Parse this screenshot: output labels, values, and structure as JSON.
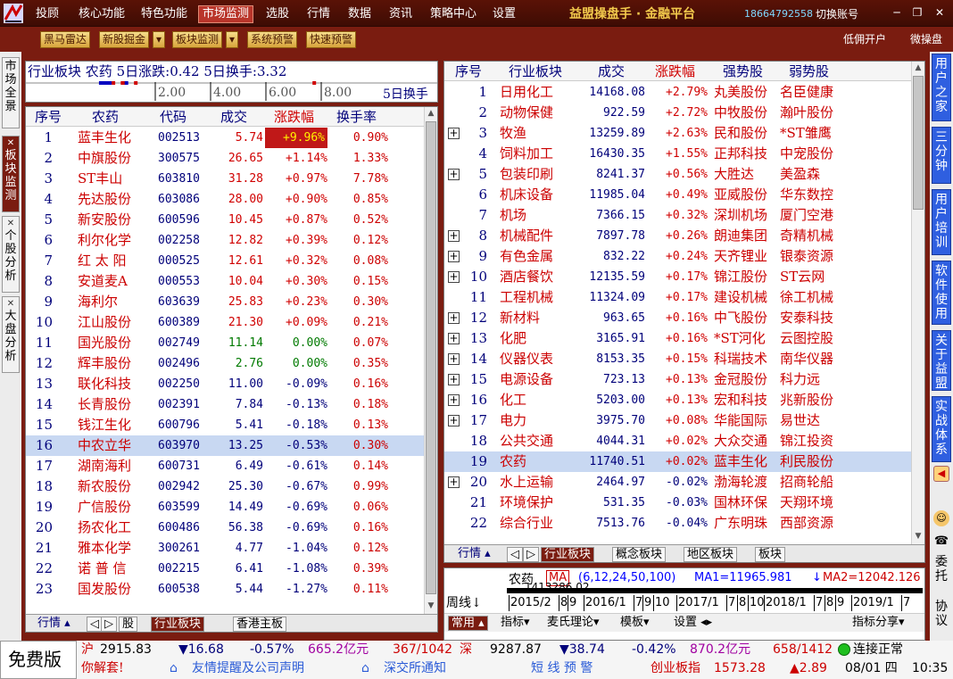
{
  "topbar": {
    "menu": [
      "投顾",
      "核心功能",
      "特色功能",
      "市场监测",
      "选股",
      "行情",
      "数据",
      "资讯",
      "策略中心",
      "设置"
    ],
    "active_index": 3,
    "brand": "益盟操盘手 · 金融平台",
    "phone": "18664792558",
    "switch_account": "切换账号",
    "win_controls": [
      "─",
      "❐",
      "✕"
    ]
  },
  "toolbar": {
    "buttons": [
      "黑马雷达",
      "新股掘金",
      "板块监测",
      "系统预警",
      "快速预警"
    ],
    "right": [
      "低佣开户",
      "微操盘"
    ]
  },
  "left_tabs": [
    "市场全景",
    "板块监测",
    "个股分析",
    "大盘分析"
  ],
  "left_tabs_active": 1,
  "summary": {
    "label": "行业板块",
    "sector": "农药",
    "gain_label": "5日涨跌:",
    "gain": "0.42",
    "turnover_label": "5日换手:",
    "turnover": "3.32",
    "ticks": [
      "2.00",
      "4.00",
      "6.00",
      "8.00"
    ],
    "axis_title": "5日换手"
  },
  "stock_table": {
    "headers": [
      "序号",
      "农药",
      "代码",
      "成交",
      "涨跌幅",
      "换手率"
    ],
    "rows": [
      [
        "1",
        "蓝丰生化",
        "002513",
        "5.74",
        "+9.96%",
        "0.90%"
      ],
      [
        "2",
        "中旗股份",
        "300575",
        "26.65",
        "+1.14%",
        "1.33%"
      ],
      [
        "3",
        "ST丰山",
        "603810",
        "31.28",
        "+0.97%",
        "7.78%"
      ],
      [
        "4",
        "先达股份",
        "603086",
        "28.00",
        "+0.90%",
        "0.85%"
      ],
      [
        "5",
        "新安股份",
        "600596",
        "10.45",
        "+0.87%",
        "0.52%"
      ],
      [
        "6",
        "利尔化学",
        "002258",
        "12.82",
        "+0.39%",
        "0.12%"
      ],
      [
        "7",
        "红 太 阳",
        "000525",
        "12.61",
        "+0.32%",
        "0.08%"
      ],
      [
        "8",
        "安道麦A",
        "000553",
        "10.04",
        "+0.30%",
        "0.15%"
      ],
      [
        "9",
        "海利尔",
        "603639",
        "25.83",
        "+0.23%",
        "0.30%"
      ],
      [
        "10",
        "江山股份",
        "600389",
        "21.30",
        "+0.09%",
        "0.21%"
      ],
      [
        "11",
        "国光股份",
        "002749",
        "11.14",
        "0.00%",
        "0.07%"
      ],
      [
        "12",
        "辉丰股份",
        "002496",
        "2.76",
        "0.00%",
        "0.35%"
      ],
      [
        "13",
        "联化科技",
        "002250",
        "11.00",
        "-0.09%",
        "0.16%"
      ],
      [
        "14",
        "长青股份",
        "002391",
        "7.84",
        "-0.13%",
        "0.18%"
      ],
      [
        "15",
        "钱江生化",
        "600796",
        "5.41",
        "-0.18%",
        "0.13%"
      ],
      [
        "16",
        "中农立华",
        "603970",
        "13.25",
        "-0.53%",
        "0.30%"
      ],
      [
        "17",
        "湖南海利",
        "600731",
        "6.49",
        "-0.61%",
        "0.14%"
      ],
      [
        "18",
        "新农股份",
        "002942",
        "25.30",
        "-0.67%",
        "0.99%"
      ],
      [
        "19",
        "广信股份",
        "603599",
        "14.49",
        "-0.69%",
        "0.06%"
      ],
      [
        "20",
        "扬农化工",
        "600486",
        "56.38",
        "-0.69%",
        "0.16%"
      ],
      [
        "21",
        "雅本化学",
        "300261",
        "4.77",
        "-1.04%",
        "0.12%"
      ],
      [
        "22",
        "诺 普 信",
        "002215",
        "6.41",
        "-1.08%",
        "0.39%"
      ],
      [
        "23",
        "国发股份",
        "600538",
        "5.44",
        "-1.27%",
        "0.11%"
      ]
    ],
    "selected_index": 15
  },
  "left_tabbar": {
    "label": "行情",
    "items": [
      "股",
      "行业板块",
      "香港主板"
    ],
    "active": 1
  },
  "sector_table": {
    "headers": [
      "序号",
      "行业板块",
      "成交",
      "涨跌幅",
      "强势股",
      "弱势股"
    ],
    "rows": [
      [
        "1",
        "日用化工",
        "14168.08",
        "+2.79%",
        "丸美股份",
        "名臣健康",
        false
      ],
      [
        "2",
        "动物保健",
        "922.59",
        "+2.72%",
        "中牧股份",
        "瀚叶股份",
        false
      ],
      [
        "3",
        "牧渔",
        "13259.89",
        "+2.63%",
        "民和股份",
        "*ST雏鹰",
        true
      ],
      [
        "4",
        "饲料加工",
        "16430.35",
        "+1.55%",
        "正邦科技",
        "中宠股份",
        false
      ],
      [
        "5",
        "包装印刷",
        "8241.37",
        "+0.56%",
        "大胜达",
        "美盈森",
        true
      ],
      [
        "6",
        "机床设备",
        "11985.04",
        "+0.49%",
        "亚威股份",
        "华东数控",
        false
      ],
      [
        "7",
        "机场",
        "7366.15",
        "+0.32%",
        "深圳机场",
        "厦门空港",
        false
      ],
      [
        "8",
        "机械配件",
        "7897.78",
        "+0.26%",
        "朗迪集团",
        "奇精机械",
        true
      ],
      [
        "9",
        "有色金属",
        "832.22",
        "+0.24%",
        "天齐锂业",
        "银泰资源",
        true
      ],
      [
        "10",
        "酒店餐饮",
        "12135.59",
        "+0.17%",
        "锦江股份",
        "ST云网",
        true
      ],
      [
        "11",
        "工程机械",
        "11324.09",
        "+0.17%",
        "建设机械",
        "徐工机械",
        false
      ],
      [
        "12",
        "新材料",
        "963.65",
        "+0.16%",
        "中飞股份",
        "安泰科技",
        true
      ],
      [
        "13",
        "化肥",
        "3165.91",
        "+0.16%",
        "*ST河化",
        "云图控股",
        true
      ],
      [
        "14",
        "仪器仪表",
        "8153.35",
        "+0.15%",
        "科瑞技术",
        "南华仪器",
        true
      ],
      [
        "15",
        "电源设备",
        "723.13",
        "+0.13%",
        "金冠股份",
        "科力远",
        true
      ],
      [
        "16",
        "化工",
        "5203.00",
        "+0.13%",
        "宏和科技",
        "兆新股份",
        true
      ],
      [
        "17",
        "电力",
        "3975.70",
        "+0.08%",
        "华能国际",
        "易世达",
        true
      ],
      [
        "18",
        "公共交通",
        "4044.31",
        "+0.02%",
        "大众交通",
        "锦江投资",
        false
      ],
      [
        "19",
        "农药",
        "11740.51",
        "+0.02%",
        "蓝丰生化",
        "利民股份",
        false
      ],
      [
        "20",
        "水上运输",
        "2464.97",
        "-0.02%",
        "渤海轮渡",
        "招商轮船",
        true
      ],
      [
        "21",
        "环境保护",
        "531.35",
        "-0.03%",
        "国林环保",
        "天翔环境",
        false
      ],
      [
        "22",
        "综合行业",
        "7513.76",
        "-0.04%",
        "广东明珠",
        "西部资源",
        false
      ]
    ],
    "selected_index": 18
  },
  "right_tabbar": {
    "label": "行情",
    "items": [
      "行业板块",
      "概念板块",
      "地区板块",
      "板块"
    ],
    "active": 0
  },
  "mini_chart": {
    "name": "农药",
    "ma_tag": "MA",
    "params": "(6,12,24,50,100)",
    "ma1": "MA1=11965.981",
    "ma2": "MA2=12042.126",
    "overlay": "1413286.02",
    "period": "周线",
    "years": [
      "2015/2",
      "8",
      "9",
      "2016/1",
      "7",
      "9",
      "10",
      "2017/1",
      "7",
      "8",
      "10",
      "2018/1",
      "7",
      "8",
      "9",
      "2019/1",
      "7"
    ],
    "tools": [
      "常用",
      "指标",
      "麦氏理论",
      "模板",
      "设置"
    ],
    "share": "指标分享"
  },
  "right_tabs": [
    "用户之家",
    "三分钟",
    "用户培训",
    "软件使用",
    "关于益盟",
    "实战体系"
  ],
  "right_bottom": [
    "委托",
    "协议"
  ],
  "status": {
    "edition": "免费版",
    "sh": {
      "label": "沪",
      "index": "2915.83",
      "chg": "▼16.68",
      "pct": "-0.57%",
      "amount": "665.2亿元",
      "updown": "367/1042"
    },
    "sz": {
      "label": "深",
      "index": "9287.87",
      "chg": "▼38.74",
      "pct": "-0.42%",
      "amount": "870.2亿元",
      "updown": "658/1412"
    },
    "conn": "连接正常",
    "greet": "你解套!",
    "notice1": "友情提醒及公司声明",
    "notice2": "深交所通知",
    "alert": "短 线 预 警",
    "cyb_label": "创业板指",
    "cyb_value": "1573.28",
    "cyb_chg": "▲2.89",
    "date": "08/01 四",
    "time": "10:35"
  }
}
